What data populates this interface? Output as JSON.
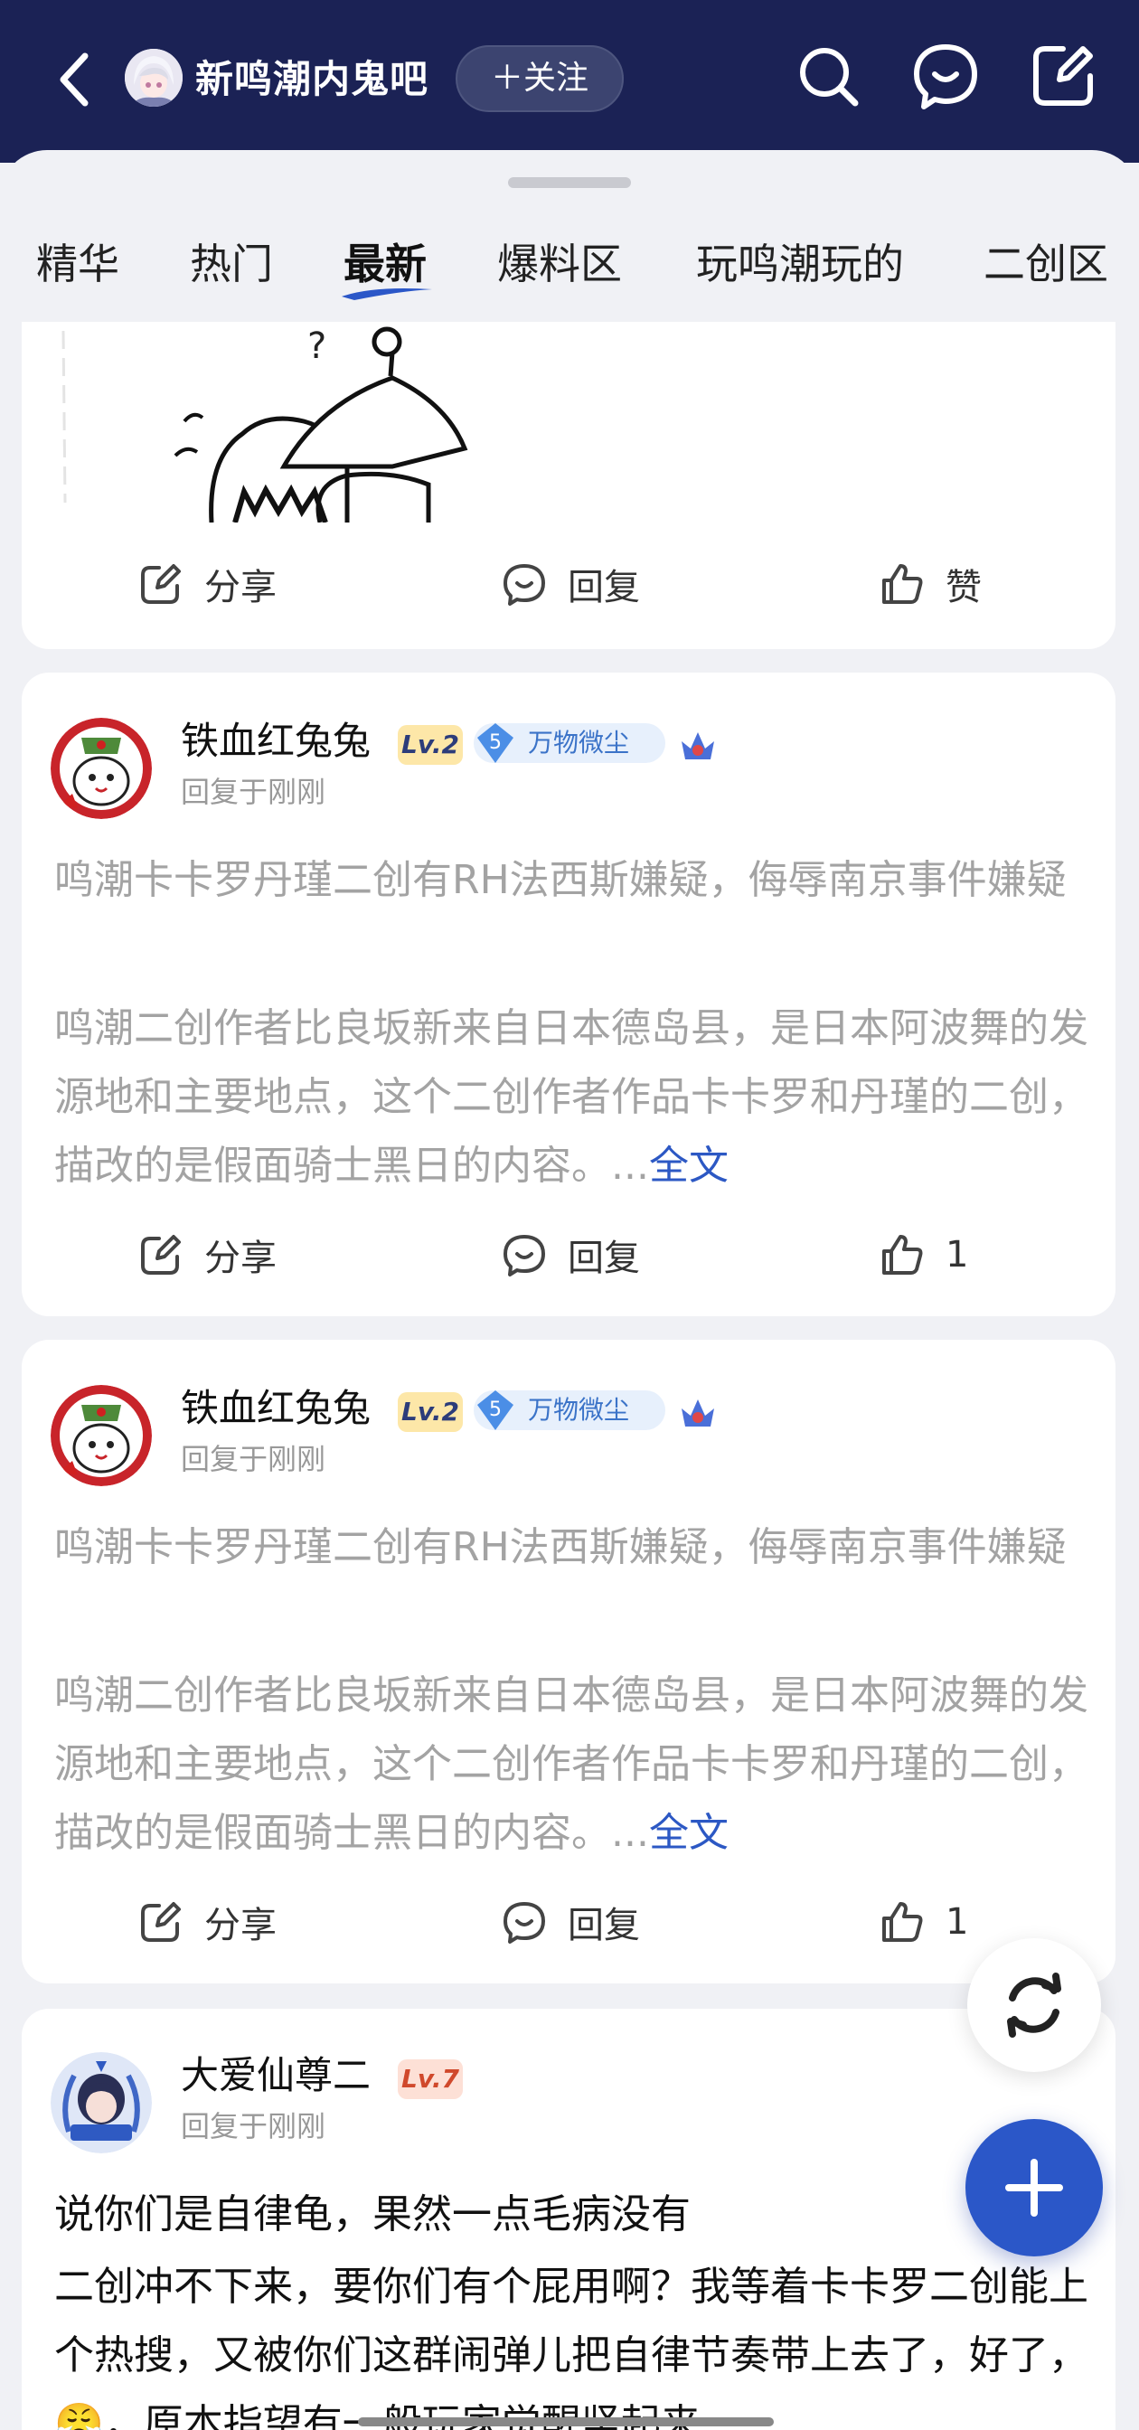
{
  "header": {
    "forum_name": "新鸣潮内鬼吧",
    "follow_label": "＋关注"
  },
  "tabs": [
    {
      "label": "精华"
    },
    {
      "label": "热门"
    },
    {
      "label": "最新",
      "active": true
    },
    {
      "label": "爆料区"
    },
    {
      "label": "玩鸣潮玩的"
    },
    {
      "label": "二创区"
    }
  ],
  "actions": {
    "share": "分享",
    "reply": "回复",
    "like": "赞"
  },
  "posts": [
    {
      "author": "铁血红兔兔",
      "level": "Lv.2",
      "badge_num": "5",
      "badge_text": "万物微尘",
      "subtitle": "回复于刚刚",
      "title": "鸣潮卡卡罗丹瑾二创有RH法西斯嫌疑，侮辱南京事件嫌疑",
      "body": "鸣潮二创作者比良坂新来自日本德岛县，是日本阿波舞的发源地和主要地点，这个二创作者作品卡卡罗和丹瑾的二创，描改的是假面骑士黑日的内容。...",
      "more": "全文",
      "likes": "1"
    },
    {
      "author": "铁血红兔兔",
      "level": "Lv.2",
      "badge_num": "5",
      "badge_text": "万物微尘",
      "subtitle": "回复于刚刚",
      "title": "鸣潮卡卡罗丹瑾二创有RH法西斯嫌疑，侮辱南京事件嫌疑",
      "body": "鸣潮二创作者比良坂新来自日本德岛县，是日本阿波舞的发源地和主要地点，这个二创作者作品卡卡罗和丹瑾的二创，描改的是假面骑士黑日的内容。...",
      "more": "全文",
      "likes": "1"
    },
    {
      "author": "大爱仙尊二",
      "level": "Lv.7",
      "subtitle": "回复于刚刚",
      "title": "说你们是自律龟，果然一点毛病没有",
      "body": "二创冲不下来，要你们有个屁用啊？我等着卡卡罗二创能上个热搜，又被你们这群闹弹儿把自律节奏带上去了，好了，😤，原本指望有一般玩家觉醒竖起来"
    }
  ],
  "colors": {
    "header_bg": "#1b2255",
    "accent_blue": "#2b57c8",
    "link": "#2c58c4"
  }
}
